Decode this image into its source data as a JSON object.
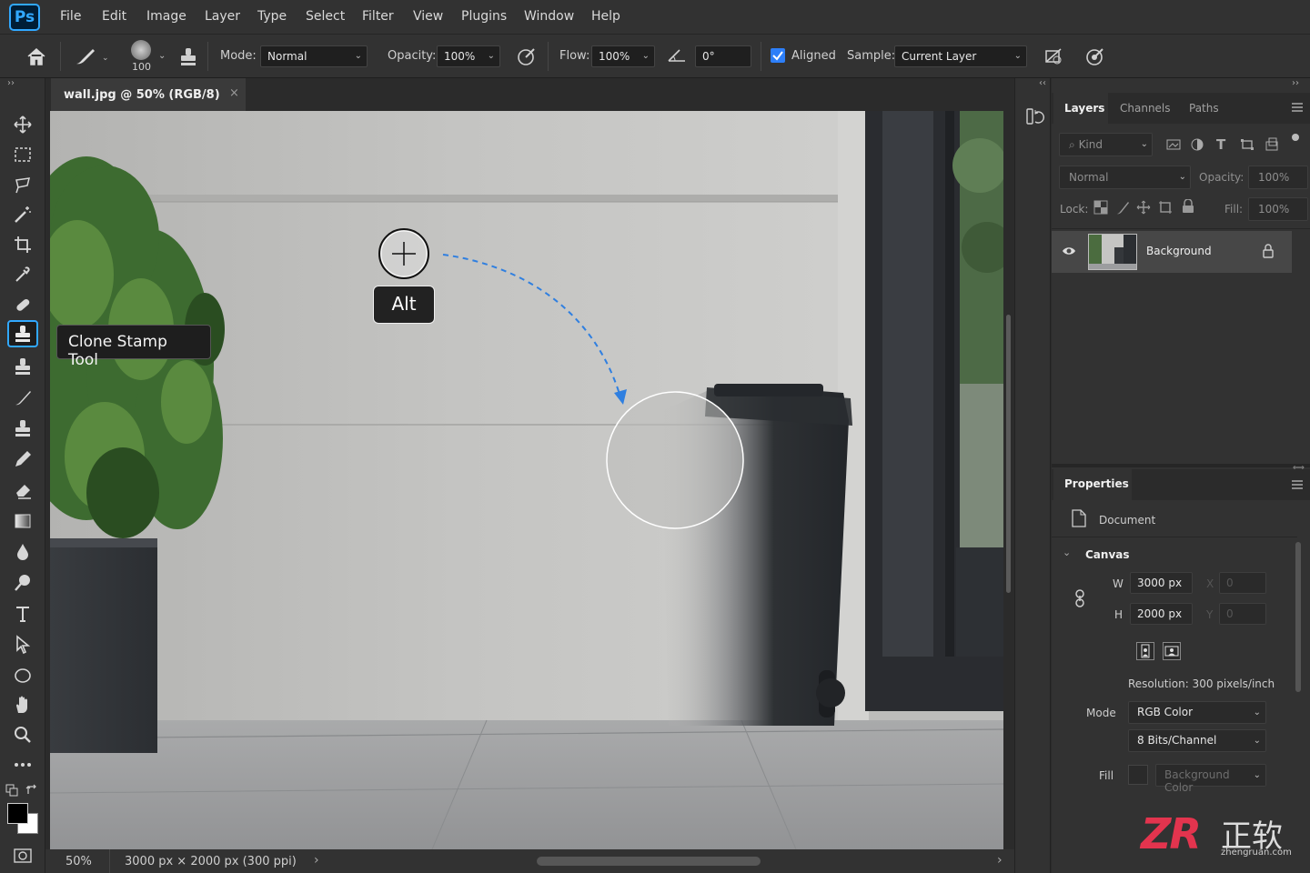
{
  "app": {
    "logo": "Ps"
  },
  "menu": [
    "File",
    "Edit",
    "Image",
    "Layer",
    "Type",
    "Select",
    "Filter",
    "View",
    "Plugins",
    "Window",
    "Help"
  ],
  "options": {
    "brush_size": "100",
    "mode_label": "Mode:",
    "mode_value": "Normal",
    "opacity_label": "Opacity:",
    "opacity_value": "100%",
    "flow_label": "Flow:",
    "flow_value": "100%",
    "angle_value": "0°",
    "aligned_label": "Aligned",
    "aligned_checked": true,
    "sample_label": "Sample:",
    "sample_value": "Current Layer"
  },
  "document": {
    "tab_title": "wall.jpg @ 50% (RGB/8)",
    "close": "×",
    "zoom": "50%",
    "info": "3000 px × 2000 px (300 ppi)"
  },
  "tooltip": {
    "text": "Clone Stamp Tool"
  },
  "canvas_overlay": {
    "key_label": "Alt",
    "arrow_color": "#2f7fe0"
  },
  "layers_panel": {
    "tabs": [
      "Layers",
      "Channels",
      "Paths"
    ],
    "filter_placeholder": "Kind",
    "blend_mode": "Normal",
    "opacity_label": "Opacity:",
    "opacity_value": "100%",
    "lock_label": "Lock:",
    "fill_label": "Fill:",
    "fill_value": "100%",
    "layers": [
      {
        "name": "Background",
        "visible": true,
        "locked": true
      }
    ]
  },
  "properties_panel": {
    "title": "Properties",
    "document_label": "Document",
    "canvas_label": "Canvas",
    "w_label": "W",
    "w_value": "3000 px",
    "h_label": "H",
    "h_value": "2000 px",
    "x_label": "X",
    "x_value": "0",
    "y_label": "Y",
    "y_value": "0",
    "resolution": "Resolution: 300 pixels/inch",
    "mode_label": "Mode",
    "mode_value": "RGB Color",
    "bits_value": "8 Bits/Channel",
    "fill_label": "Fill",
    "fill_value": "Background Color"
  },
  "watermark": {
    "logo": "ZR",
    "chinese": "正软",
    "site": "zhengruan.com"
  },
  "colors": {
    "accent": "#31a8ff",
    "panel_bg": "#323232",
    "checkbox": "#2d7ff9"
  }
}
